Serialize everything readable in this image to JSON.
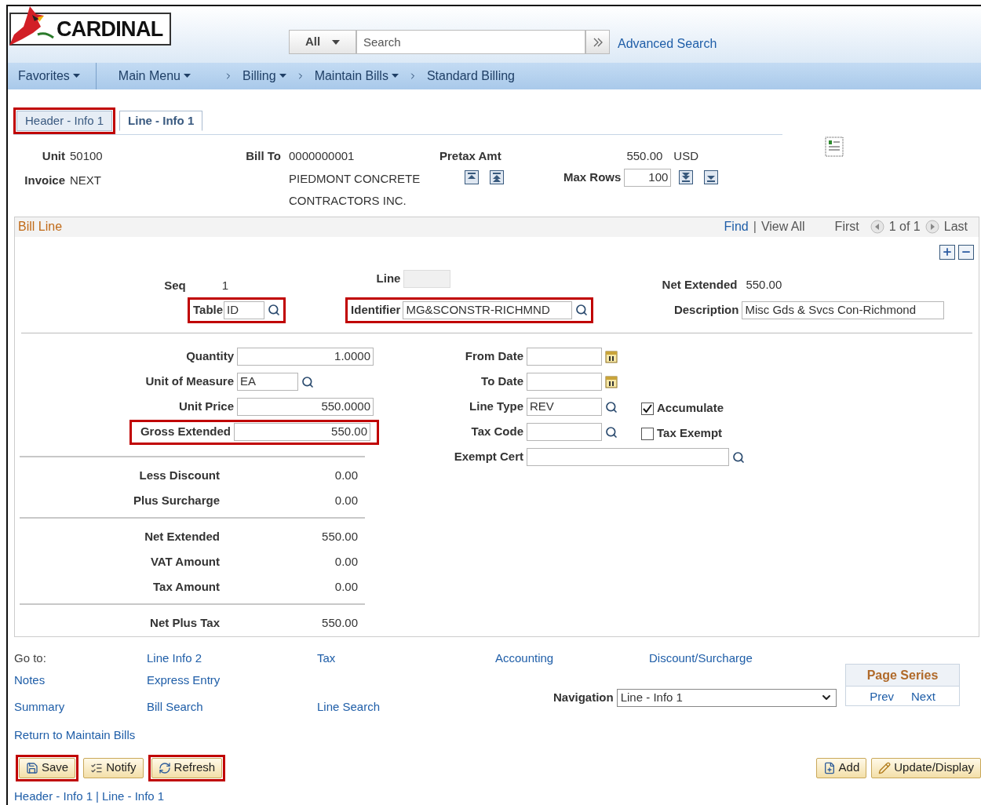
{
  "logo": {
    "text": "CARDINAL"
  },
  "search": {
    "scope": "All",
    "placeholder": "Search",
    "advanced_link": "Advanced Search"
  },
  "nav": [
    {
      "label": "Favorites",
      "dropdown": true,
      "chevron_before": false
    },
    {
      "label": "Main Menu",
      "dropdown": true,
      "chevron_before": false
    },
    {
      "label": "Billing",
      "dropdown": true,
      "chevron_before": true
    },
    {
      "label": "Maintain Bills",
      "dropdown": true,
      "chevron_before": true
    },
    {
      "label": "Standard Billing",
      "dropdown": false,
      "chevron_before": true
    }
  ],
  "tabs": [
    {
      "label": "Header - Info 1",
      "selected": false,
      "highlighted": true
    },
    {
      "label": "Line - Info 1",
      "selected": true,
      "highlighted": false
    }
  ],
  "header": {
    "unit_label": "Unit",
    "unit": "50100",
    "invoice_label": "Invoice",
    "invoice": "NEXT",
    "bill_to_label": "Bill To",
    "bill_to": "0000000001",
    "bill_to_name": [
      "PIEDMONT CONCRETE",
      "CONTRACTORS INC."
    ],
    "pretax_label": "Pretax Amt",
    "pretax_amount": "550.00",
    "currency": "USD",
    "max_rows_label": "Max Rows",
    "max_rows": "100"
  },
  "bill_line": {
    "title": "Bill Line",
    "find": "Find",
    "separator": "|",
    "view_all": "View All",
    "first": "First",
    "count": "1 of 1",
    "last": "Last",
    "seq_label": "Seq",
    "seq": "1",
    "line_label": "Line",
    "table": {
      "label": "Table",
      "value": "ID",
      "highlighted": true
    },
    "identifier": {
      "label": "Identifier",
      "value": "MG&SCONSTR-RICHMND",
      "highlighted": true
    },
    "net_extended_label": "Net Extended",
    "net_extended": "550.00",
    "description": {
      "label": "Description",
      "value": "Misc Gds & Svcs Con-Richmond"
    },
    "left_fields": [
      {
        "label": "Quantity",
        "value": "1.0000",
        "lookup": false,
        "highlighted": false
      },
      {
        "label": "Unit of Measure",
        "value": "EA",
        "lookup": true,
        "highlighted": false
      },
      {
        "label": "Unit Price",
        "value": "550.0000",
        "lookup": false,
        "highlighted": false
      },
      {
        "label": "Gross Extended",
        "value": "550.00",
        "lookup": false,
        "highlighted": true
      }
    ],
    "right_fields": [
      {
        "label": "From Date",
        "kind": "date"
      },
      {
        "label": "To Date",
        "kind": "date"
      },
      {
        "label": "Line Type",
        "kind": "lookup",
        "value": "REV",
        "checkbox": {
          "label": "Accumulate",
          "checked": true
        }
      },
      {
        "label": "Tax Code",
        "kind": "lookup",
        "checkbox": {
          "label": "Tax Exempt",
          "checked": false
        }
      },
      {
        "label": "Exempt Cert",
        "kind": "wide"
      }
    ],
    "totals": [
      [
        {
          "label": "Less Discount",
          "value": "0.00"
        },
        {
          "label": "Plus Surcharge",
          "value": "0.00"
        }
      ],
      [
        {
          "label": "Net Extended",
          "value": "550.00"
        },
        {
          "label": "VAT Amount",
          "value": "0.00"
        },
        {
          "label": "Tax Amount",
          "value": "0.00"
        }
      ],
      [
        {
          "label": "Net Plus Tax",
          "value": "550.00"
        }
      ]
    ]
  },
  "goto": {
    "rows": [
      [
        {
          "kind": "label",
          "text": "Go to:"
        },
        {
          "kind": "link",
          "text": "Line Info 2"
        },
        {
          "kind": "link",
          "text": "Tax"
        },
        {
          "kind": "link",
          "text": "Accounting"
        },
        {
          "kind": "link",
          "text": "Discount/Surcharge"
        }
      ],
      [
        {
          "kind": "link",
          "text": "Notes"
        },
        {
          "kind": "link",
          "text": "Express Entry"
        }
      ],
      [
        {
          "kind": "link",
          "text": "Summary"
        },
        {
          "kind": "link",
          "text": "Bill Search"
        },
        {
          "kind": "link",
          "text": "Line Search"
        }
      ],
      [
        {
          "kind": "link",
          "text": "Return to Maintain Bills"
        }
      ]
    ]
  },
  "navigation": {
    "label": "Navigation",
    "value": "Line - Info 1"
  },
  "page_series": {
    "title": "Page Series",
    "prev": "Prev",
    "next": "Next"
  },
  "buttons_left": [
    {
      "label": "Save",
      "highlighted": true
    },
    {
      "label": "Notify",
      "highlighted": false
    },
    {
      "label": "Refresh",
      "highlighted": true
    }
  ],
  "buttons_right": [
    {
      "label": "Add"
    },
    {
      "label": "Update/Display"
    }
  ],
  "footer_links": [
    "Header - Info 1",
    "Line - Info 1"
  ],
  "footer_separator": "|"
}
